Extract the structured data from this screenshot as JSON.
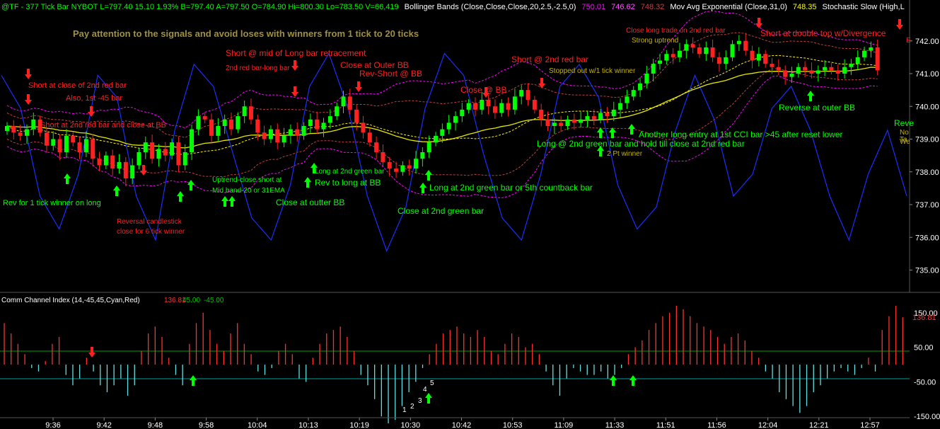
{
  "header": {
    "segments": [
      {
        "text": "@TF - 377 Tick Bar  NYBOT  L=797.40  15.10  1.93%  B=797.40  A=797.50  O=784.90  Hi=800.30  Lo=783.50  V=66,419",
        "color": "#00ff00"
      },
      {
        "text": "Bollinger Bands (Close,Close,Close,20,2.5,-2.5,0)",
        "color": "#ffffff"
      },
      {
        "text": "750.01",
        "color": "#ff00ff"
      },
      {
        "text": "746.62",
        "color": "#ff55ff"
      },
      {
        "text": "748.32",
        "color": "#c04040"
      },
      {
        "text": "Mov Avg Exponential (Close,31,0)",
        "color": "#ffffff"
      },
      {
        "text": "748.35",
        "color": "#ffff00"
      },
      {
        "text": "Stochastic Slow (High,L",
        "color": "#ffffff"
      }
    ]
  },
  "headline": "Pay attention to the signals and avoid loses with winners from 1 tick to 20 ticks",
  "price_axis_labels": [
    "742.00",
    "741.00",
    "740.00",
    "739.00",
    "738.00",
    "737.00",
    "736.00",
    "735.00"
  ],
  "time_axis_labels": [
    "9:36",
    "9:42",
    "9:48",
    "9:58",
    "10:04",
    "10:13",
    "10:19",
    "10:30",
    "10:42",
    "10:53",
    "11:09",
    "11:33",
    "11:51",
    "11:56",
    "12:04",
    "12:21",
    "12:57"
  ],
  "cci": {
    "title": "Comm Channel Index (14,-45,45,Cyan,Red)",
    "value": "136.81",
    "upper": "45.00",
    "lower": "-45.00",
    "axis_labels": [
      "150.00",
      "50.00",
      "-50.00",
      "-150.00"
    ],
    "current_label": "136.81"
  },
  "annotations": [
    {
      "text": "Short at close of 2nd red bar",
      "color": "#ff2020"
    },
    {
      "text": "Also, 1st -45 bar",
      "color": "#ff2020"
    },
    {
      "text": "Short at 2nd red bar and close at BB",
      "color": "#ff2020"
    },
    {
      "text": "Rev for 1 tick winner on long",
      "color": "#00ff00"
    },
    {
      "text": "Reversal candlestick",
      "color": "#ff2020"
    },
    {
      "text": "close for 6 tick winner",
      "color": "#ff2020"
    },
    {
      "text": "Short @ mid of Long bar retracement",
      "color": "#ff2020"
    },
    {
      "text": "2nd red bar-long bar",
      "color": "#ff2020"
    },
    {
      "text": "Uptrend-close short at",
      "color": "#00ff00"
    },
    {
      "text": "Mid band-20 or 31EMA",
      "color": "#00ff00"
    },
    {
      "text": "Close at outter BB",
      "color": "#00ff00"
    },
    {
      "text": "Close at Outer BB",
      "color": "#ff2020"
    },
    {
      "text": "Rev-Short @ BB",
      "color": "#ff2020"
    },
    {
      "text": "Long at 2nd green bar",
      "color": "#00ff00"
    },
    {
      "text": "Rev to long at BB",
      "color": "#00ff00"
    },
    {
      "text": "Long at 2nd green bar or 5th countback bar",
      "color": "#00ff00"
    },
    {
      "text": "Close at 2nd green bar",
      "color": "#00ff00"
    },
    {
      "text": "Close @ BB",
      "color": "#ff2020"
    },
    {
      "text": "Short @ 2nd red bar",
      "color": "#ff2020"
    },
    {
      "text": "Stopped out w/1 tick winner",
      "color": "#c8b400"
    },
    {
      "text": "Close long trade on 2nd red bar",
      "color": "#ff2020"
    },
    {
      "text": "Strong uptrend",
      "color": "#c8b400"
    },
    {
      "text": "Short at double top w/Divergence",
      "color": "#ff2020"
    },
    {
      "text": "Reverse at outer BB",
      "color": "#00ff00"
    },
    {
      "text": "Long @ 2nd green bar and hold till close at 2nd red bar",
      "color": "#00ff00"
    },
    {
      "text": "Another long entry at 1st CCI bar >45 after reset lower",
      "color": "#00ff00"
    },
    {
      "text": "2 Pt winner",
      "color": "#c8b400"
    },
    {
      "text": "Reve",
      "color": "#00ff00"
    },
    {
      "text": "No",
      "color": "#c8b400"
    },
    {
      "text": "Ta",
      "color": "#c8b400"
    },
    {
      "text": "We",
      "color": "#c8b400"
    },
    {
      "text": "E",
      "color": "#ff2020"
    }
  ],
  "countback_numbers": [
    "1",
    "2",
    "3",
    "4",
    "5"
  ],
  "colors": {
    "background": "#000000",
    "up_candle": "#00ff00",
    "down_candle": "#ff2020",
    "ema": "#ffff00",
    "bb_mid": "#fff200",
    "bb_outer": "#ff00ff",
    "bb_inner": "#c04040",
    "stochastic": "#1a2fff",
    "cci_pos": "#ff3030",
    "cci_neg": "#60e0e0",
    "grid": "#202020",
    "axis_text": "#ffffff"
  },
  "chart_data": {
    "type": "candlestick",
    "title": "@TF - 377 Tick Bar",
    "ylim": [
      734.6,
      742.6
    ],
    "x": [
      "9:36",
      "9:42",
      "9:48",
      "9:58",
      "10:04",
      "10:13",
      "10:19",
      "10:30",
      "10:42",
      "10:53",
      "11:09",
      "11:33",
      "11:51",
      "11:56",
      "12:04",
      "12:21",
      "12:57"
    ],
    "close_path": [
      739.4,
      739.2,
      739.1,
      739.3,
      739.6,
      739.2,
      738.8,
      739.0,
      738.6,
      739.1,
      738.9,
      738.6,
      739.0,
      738.4,
      738.2,
      738.5,
      738.1,
      738.3,
      737.8,
      738.2,
      738.6,
      738.9,
      738.4,
      738.7,
      738.5,
      738.9,
      738.2,
      738.6,
      739.3,
      739.7,
      739.6,
      739.1,
      739.4,
      739.6,
      739.3,
      739.7,
      740.0,
      739.6,
      739.2,
      739.0,
      739.3,
      738.9,
      739.1,
      739.3,
      739.1,
      739.4,
      739.6,
      739.3,
      739.5,
      739.7,
      740.0,
      740.3,
      739.9,
      739.5,
      739.2,
      738.9,
      738.6,
      738.3,
      738.1,
      738.0,
      738.2,
      738.1,
      738.4,
      738.6,
      738.9,
      739.1,
      739.3,
      739.5,
      739.7,
      739.9,
      740.1,
      739.9,
      740.2,
      740.0,
      739.8,
      740.1,
      739.9,
      740.3,
      740.5,
      740.2,
      739.9,
      739.6,
      739.4,
      739.5,
      739.4,
      739.6,
      739.5,
      739.6,
      739.7,
      739.6,
      739.8,
      739.7,
      739.9,
      740.1,
      740.3,
      740.5,
      740.7,
      741.0,
      741.3,
      741.4,
      741.6,
      741.5,
      741.7,
      741.9,
      741.8,
      741.6,
      741.8,
      741.5,
      741.3,
      741.5,
      741.9,
      742.0,
      741.7,
      741.4,
      741.6,
      741.3,
      741.2,
      741.1,
      740.9,
      741.0,
      741.2,
      741.1,
      741.0,
      741.1,
      741.2,
      741.1,
      741.0,
      741.2,
      741.3,
      741.5,
      741.7,
      741.8,
      741.1
    ],
    "ema31": {
      "x": [
        0,
        0.1,
        0.2,
        0.3,
        0.4,
        0.5,
        0.6,
        0.7,
        0.8,
        0.9,
        1
      ],
      "y": [
        738.6,
        738.8,
        738.9,
        738.9,
        739.2,
        739.2,
        738.9,
        739.2,
        739.8,
        740.9,
        741.0
      ]
    },
    "cci_values": [
      120,
      90,
      60,
      30,
      -10,
      -20,
      10,
      60,
      80,
      -30,
      -60,
      -40,
      20,
      -20,
      -60,
      -80,
      -60,
      -40,
      -90,
      -60,
      40,
      90,
      110,
      80,
      20,
      -30,
      -60,
      60,
      120,
      150,
      100,
      60,
      40,
      90,
      120,
      60,
      30,
      -20,
      -30,
      -10,
      40,
      60,
      30,
      -40,
      -50,
      20,
      60,
      90,
      100,
      110,
      80,
      40,
      -30,
      -60,
      -100,
      -150,
      -170,
      -160,
      -120,
      -80,
      -50,
      -10,
      30,
      60,
      90,
      100,
      110,
      90,
      80,
      100,
      80,
      40,
      30,
      60,
      90,
      80,
      50,
      60,
      30,
      -20,
      -60,
      -90,
      -40,
      -10,
      -20,
      -30,
      -30,
      -20,
      -40,
      -30,
      -10,
      30,
      50,
      70,
      100,
      120,
      140,
      150,
      170,
      160,
      140,
      120,
      110,
      100,
      80,
      60,
      80,
      90,
      70,
      40,
      20,
      -20,
      -40,
      -80,
      -100,
      -120,
      -140,
      -120,
      -80,
      -60,
      -40,
      -20,
      -10,
      -20,
      -30,
      -10,
      20,
      -20,
      100,
      140,
      170,
      136.81
    ],
    "cci_ylim": [
      -170,
      170
    ],
    "cci_bands": [
      45,
      -45
    ]
  }
}
